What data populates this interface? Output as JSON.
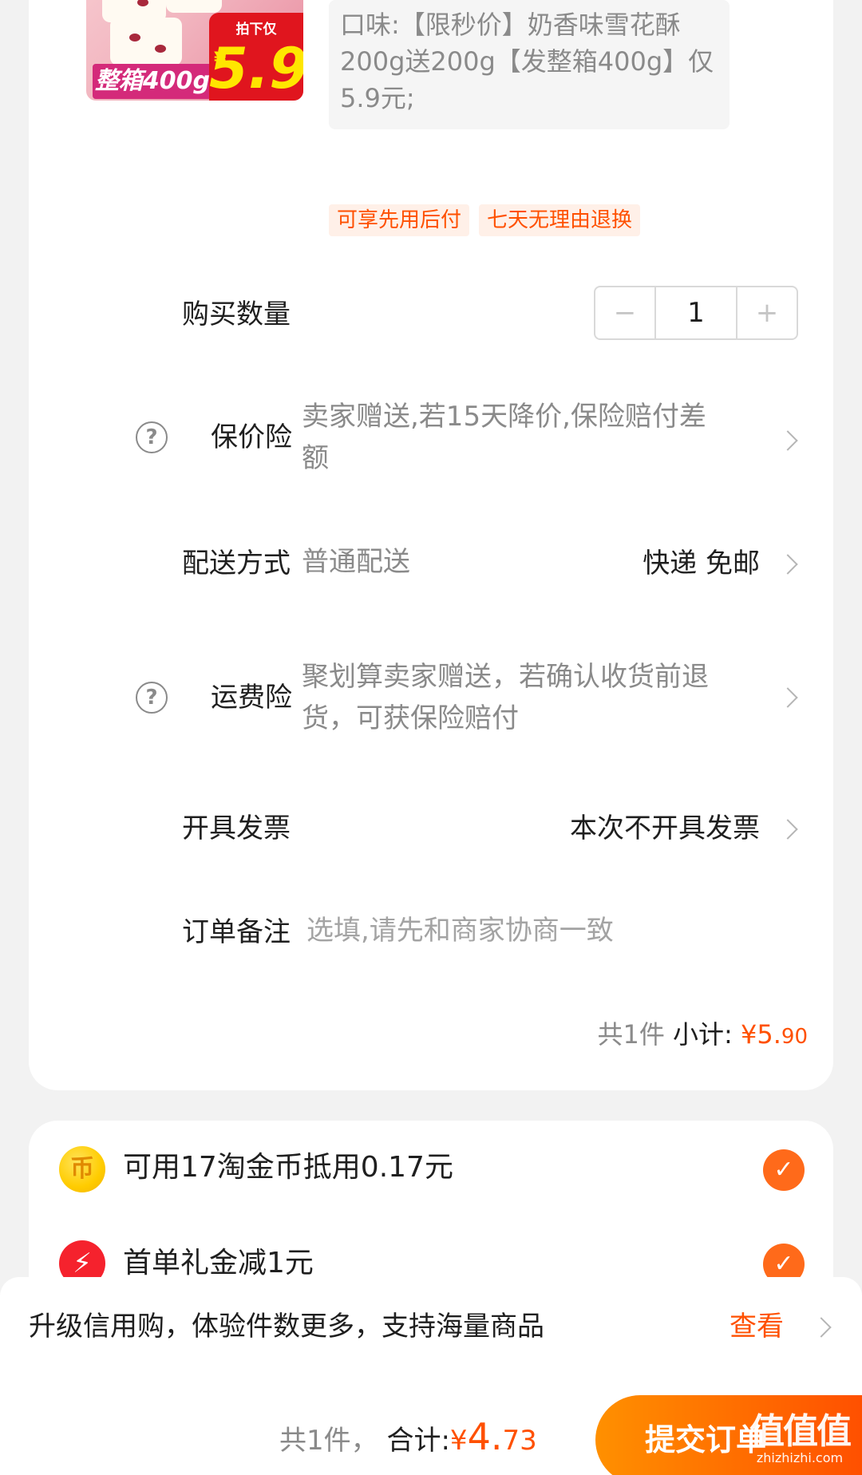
{
  "product": {
    "thumb_tag_pink": "整箱400g",
    "thumb_tag_small": "拍下仅",
    "thumb_currency": "¥",
    "thumb_price": "5.9",
    "sku_text": "口味:【限秒价】奶香味雪花酥200g送200g【发整箱400g】仅5.9元;"
  },
  "service_tags": [
    "可享先用后付",
    "七天无理由退换"
  ],
  "quantity": {
    "label": "购买数量",
    "minus": "−",
    "value": "1",
    "plus": "+"
  },
  "price_protection": {
    "label": "保价险",
    "icon": "?",
    "desc": "卖家赠送,若15天降价,保险赔付差额"
  },
  "delivery": {
    "label": "配送方式",
    "desc": "普通配送",
    "value": "快递 免邮"
  },
  "shipping_insurance": {
    "label": "运费险",
    "icon": "?",
    "desc": "聚划算卖家赠送，若确认收货前退货，可获保险赔付"
  },
  "invoice": {
    "label": "开具发票",
    "value": "本次不开具发票"
  },
  "note": {
    "label": "订单备注",
    "placeholder": "选填,请先和商家协商一致"
  },
  "subtotal": {
    "count": "共1件",
    "label": "小计:",
    "currency": "¥",
    "integer": "5.",
    "cents": "90"
  },
  "discounts": [
    {
      "icon": "币",
      "text": "可用17淘金币抵用0.17元",
      "checked": true
    },
    {
      "icon": "⚡",
      "text": "首单礼金减1元",
      "checked": true
    }
  ],
  "credit_banner": {
    "text": "升级信用购，体验件数更多，支持海量商品",
    "link": "查看"
  },
  "bottom_bar": {
    "count": "共1件，",
    "total_label": "合计:",
    "currency": "¥",
    "total_integer": "4.",
    "total_decimal": "73",
    "submit": "提交订单"
  },
  "watermark": {
    "big": "值值值",
    "small": "zhizhizhi.com"
  },
  "colors": {
    "accent": "#ff5000",
    "submit_gradient_start": "#ff9000",
    "check": "#ff6a1a"
  }
}
